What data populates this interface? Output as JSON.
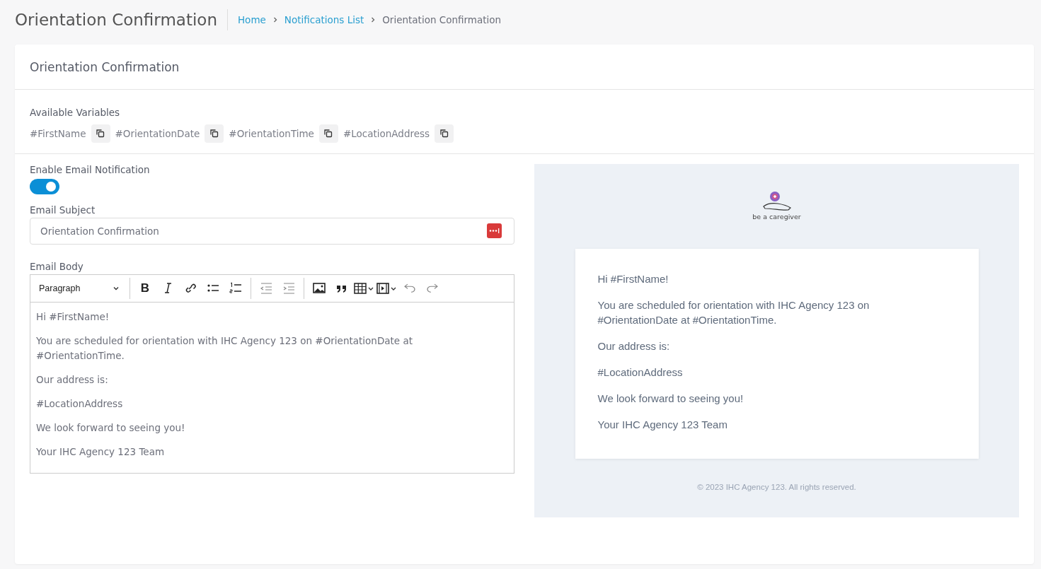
{
  "page_title": "Orientation Confirmation",
  "breadcrumb": [
    {
      "label": "Home",
      "kind": "link"
    },
    {
      "label": "Notifications List",
      "kind": "link"
    },
    {
      "label": "Orientation Confirmation",
      "kind": "current"
    }
  ],
  "card": {
    "title": "Orientation Confirmation",
    "variables": {
      "label": "Available Variables",
      "items": [
        "#FirstName",
        "#OrientationDate",
        "#OrientationTime",
        "#LocationAddress"
      ]
    },
    "email_notification": {
      "label": "Enable Email Notification",
      "on": true
    },
    "email_subject": {
      "label": "Email Subject",
      "value": "Orientation Confirmation"
    },
    "email_body": {
      "label": "Email Body",
      "block_format": "Paragraph",
      "bold_glyph": "B",
      "paragraphs": [
        "Hi #FirstName!",
        "You are scheduled for orientation with IHC Agency 123 on #OrientationDate at #OrientationTime.",
        "Our address is:",
        "#LocationAddress",
        "We look forward to seeing you!",
        "Your IHC Agency 123 Team"
      ]
    },
    "preview": {
      "logo_caption": "be a caregiver",
      "paragraphs": [
        "Hi #FirstName!",
        "You are scheduled for orientation with IHC Agency 123 on #OrientationDate at #OrientationTime.",
        "Our address is:",
        "#LocationAddress",
        "We look forward to seeing you!",
        "Your IHC Agency 123 Team"
      ],
      "footer": "© 2023 IHC Agency 123. All rights reserved."
    }
  }
}
